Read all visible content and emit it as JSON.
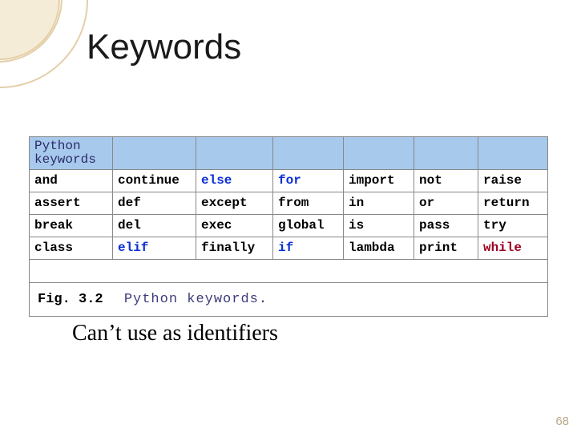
{
  "title": "Keywords",
  "subtitle": "Can’t use as identifiers",
  "page_number": "68",
  "table": {
    "header_label": "Python\nkeywords",
    "rows": [
      [
        {
          "text": "and",
          "style": "kw-black"
        },
        {
          "text": "continue",
          "style": "kw-black"
        },
        {
          "text": "else",
          "style": "kw-blue"
        },
        {
          "text": "for",
          "style": "kw-blue"
        },
        {
          "text": "import",
          "style": "kw-black"
        },
        {
          "text": "not",
          "style": "kw-black"
        },
        {
          "text": "raise",
          "style": "kw-black"
        }
      ],
      [
        {
          "text": "assert",
          "style": "kw-black"
        },
        {
          "text": "def",
          "style": "kw-black"
        },
        {
          "text": "except",
          "style": "kw-black"
        },
        {
          "text": "from",
          "style": "kw-black"
        },
        {
          "text": "in",
          "style": "kw-black"
        },
        {
          "text": "or",
          "style": "kw-black"
        },
        {
          "text": "return",
          "style": "kw-black"
        }
      ],
      [
        {
          "text": "break",
          "style": "kw-black"
        },
        {
          "text": "del",
          "style": "kw-black"
        },
        {
          "text": "exec",
          "style": "kw-black"
        },
        {
          "text": "global",
          "style": "kw-black"
        },
        {
          "text": "is",
          "style": "kw-black"
        },
        {
          "text": "pass",
          "style": "kw-black"
        },
        {
          "text": "try",
          "style": "kw-black"
        }
      ],
      [
        {
          "text": "class",
          "style": "kw-black"
        },
        {
          "text": "elif",
          "style": "kw-blue"
        },
        {
          "text": "finally",
          "style": "kw-black"
        },
        {
          "text": "if",
          "style": "kw-blue"
        },
        {
          "text": "lambda",
          "style": "kw-black"
        },
        {
          "text": "print",
          "style": "kw-black"
        },
        {
          "text": "while",
          "style": "kw-red"
        }
      ]
    ],
    "caption_label": "Fig. 3.2",
    "caption_text": "Python keywords."
  }
}
